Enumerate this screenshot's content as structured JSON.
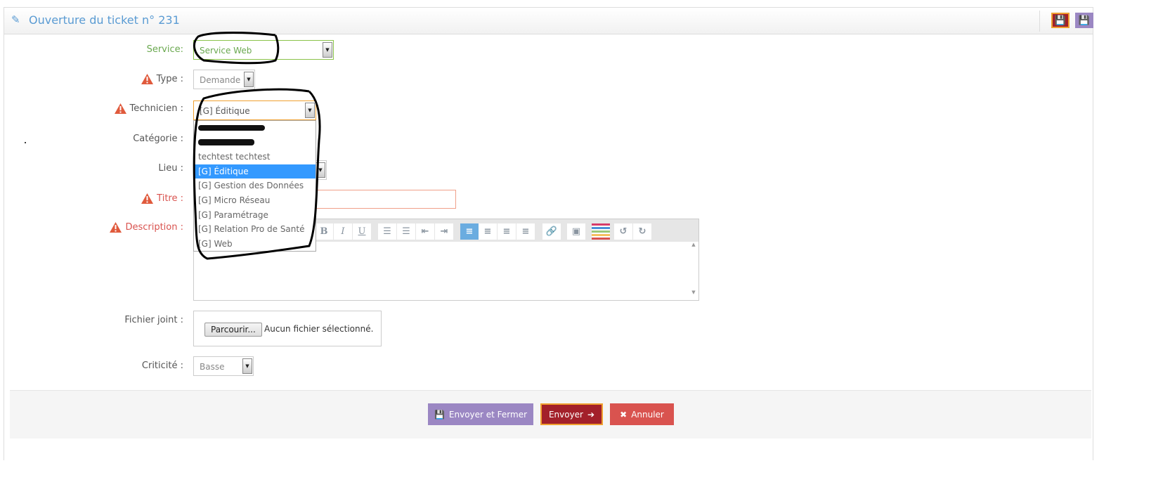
{
  "header": {
    "title": "Ouverture du ticket n° 231",
    "icon": "ticket-icon",
    "save_icon": "floppy-icon"
  },
  "form": {
    "service": {
      "label": "Service:",
      "value": "Service Web"
    },
    "type": {
      "label": "Type :",
      "value": "Demande"
    },
    "technicien": {
      "label": "Technicien :",
      "value": "[G] Éditique",
      "options": [
        "(redacted)",
        "(redacted)",
        "techtest techtest",
        "[G] Éditique",
        "[G] Gestion des Données",
        "[G] Micro Réseau",
        "[G] Paramétrage",
        "[G] Relation Pro de Santé",
        "[G] Web"
      ],
      "selected": "[G] Éditique"
    },
    "categorie": {
      "label": "Catégorie :"
    },
    "lieu": {
      "label": "Lieu :"
    },
    "titre": {
      "label": "Titre :",
      "value": ""
    },
    "description": {
      "label": "Description :",
      "toolbar": [
        "bold",
        "italic",
        "underline",
        "bullet-list",
        "numbered-list",
        "outdent",
        "indent",
        "align-left",
        "align-center",
        "align-right",
        "justify",
        "link",
        "image",
        "color",
        "undo",
        "redo"
      ]
    },
    "fichier": {
      "label": "Fichier joint :",
      "button": "Parcourir...",
      "status": "Aucun fichier sélectionné."
    },
    "criticite": {
      "label": "Criticité :",
      "value": "Basse"
    }
  },
  "footer": {
    "send_close": "Envoyer et Fermer",
    "send": "Envoyer",
    "cancel": "Annuler"
  },
  "colors": {
    "accent": "#5a9bd3",
    "purple": "#9b87c3",
    "darkred": "#a3202a",
    "danger": "#d9534f",
    "selected": "#3399ff",
    "orange": "#f0a030"
  }
}
